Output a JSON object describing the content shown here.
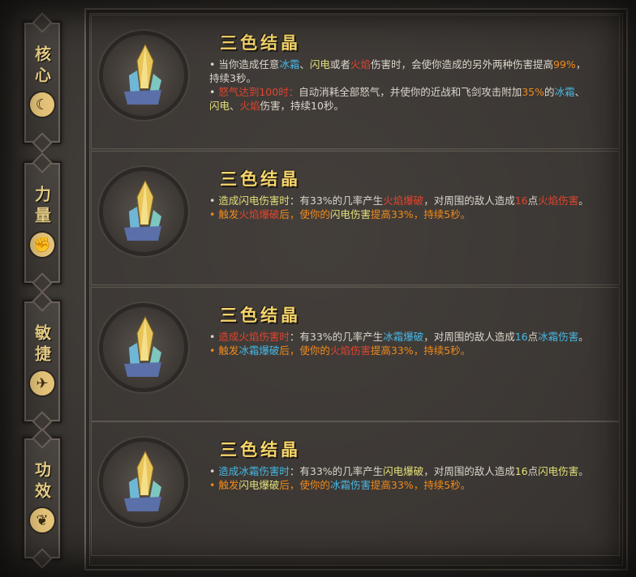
{
  "colors": {
    "title_gold": "#f6d56a",
    "fire_red": "#e0452f",
    "frost_blue": "#46b8e6",
    "lightning_yellow": "#e3e07a",
    "orange_line": "#f08a1c",
    "body_text": "#dcd6cc"
  },
  "nav": {
    "tabs": [
      {
        "label": "核心",
        "icon": "crescent-moon-icon",
        "icon_glyph": "☾"
      },
      {
        "label": "力量",
        "icon": "fist-icon",
        "icon_glyph": "✊"
      },
      {
        "label": "敏捷",
        "icon": "leaping-figure-icon",
        "icon_glyph": "✈"
      },
      {
        "label": "功效",
        "icon": "leaf-icon",
        "icon_glyph": "❦"
      }
    ]
  },
  "entries": [
    {
      "title": "三色结晶",
      "icon": "tricolor-crystal-icon",
      "lines": [
        {
          "style": "normal",
          "parts": [
            {
              "t": "• 当你造成任意",
              "c": ""
            },
            {
              "t": "冰霜",
              "c": "hl-blue"
            },
            {
              "t": "、",
              "c": ""
            },
            {
              "t": "闪电",
              "c": "hl-yellow"
            },
            {
              "t": "或者",
              "c": ""
            },
            {
              "t": "火焰",
              "c": "hl-red"
            },
            {
              "t": "伤害时，会使你造成的另外两种伤害提高",
              "c": ""
            },
            {
              "t": "99%",
              "c": "hl-orange"
            },
            {
              "t": "，持续3秒。",
              "c": ""
            }
          ]
        },
        {
          "style": "normal",
          "parts": [
            {
              "t": "• ",
              "c": ""
            },
            {
              "t": "怒气达到100时：",
              "c": "hl-red"
            },
            {
              "t": "自动消耗全部怒气，并使你的近战和飞剑攻击附加",
              "c": ""
            },
            {
              "t": "35%",
              "c": "hl-orange"
            },
            {
              "t": "的",
              "c": ""
            },
            {
              "t": "冰霜",
              "c": "hl-blue"
            },
            {
              "t": "、",
              "c": ""
            },
            {
              "t": "闪电",
              "c": "hl-yellow"
            },
            {
              "t": "、",
              "c": ""
            },
            {
              "t": "火焰",
              "c": "hl-red"
            },
            {
              "t": "伤害，持续10秒。",
              "c": ""
            }
          ]
        }
      ]
    },
    {
      "title": "三色结晶",
      "icon": "tricolor-crystal-icon",
      "lines": [
        {
          "style": "normal",
          "parts": [
            {
              "t": "• ",
              "c": ""
            },
            {
              "t": "造成闪电伤害时",
              "c": "hl-yellow"
            },
            {
              "t": "：有33%的几率产生",
              "c": ""
            },
            {
              "t": "火焰爆破",
              "c": "hl-red"
            },
            {
              "t": "，对周围的敌人造成",
              "c": ""
            },
            {
              "t": "16",
              "c": "hl-red"
            },
            {
              "t": "点",
              "c": ""
            },
            {
              "t": "火焰伤害",
              "c": "hl-red"
            },
            {
              "t": "。",
              "c": ""
            }
          ]
        },
        {
          "style": "orange",
          "parts": [
            {
              "t": "• 触发",
              "c": ""
            },
            {
              "t": "火焰爆破",
              "c": "hl-red"
            },
            {
              "t": "后，使你的",
              "c": ""
            },
            {
              "t": "闪电伤害",
              "c": "hl-yellow"
            },
            {
              "t": "提高33%，持续5秒。",
              "c": ""
            }
          ]
        }
      ]
    },
    {
      "title": "三色结晶",
      "icon": "tricolor-crystal-icon",
      "lines": [
        {
          "style": "normal",
          "parts": [
            {
              "t": "• ",
              "c": ""
            },
            {
              "t": "造成火焰伤害时",
              "c": "hl-red"
            },
            {
              "t": "：有33%的几率产生",
              "c": ""
            },
            {
              "t": "冰霜爆破",
              "c": "hl-blue"
            },
            {
              "t": "，对周围的敌人造成",
              "c": ""
            },
            {
              "t": "16",
              "c": "hl-blue"
            },
            {
              "t": "点",
              "c": ""
            },
            {
              "t": "冰霜伤害",
              "c": "hl-blue"
            },
            {
              "t": "。",
              "c": ""
            }
          ]
        },
        {
          "style": "orange",
          "parts": [
            {
              "t": "• 触发",
              "c": ""
            },
            {
              "t": "冰霜爆破",
              "c": "hl-blue"
            },
            {
              "t": "后，使你的",
              "c": ""
            },
            {
              "t": "火焰伤害",
              "c": "hl-red"
            },
            {
              "t": "提高33%，持续5秒。",
              "c": ""
            }
          ]
        }
      ]
    },
    {
      "title": "三色结晶",
      "icon": "tricolor-crystal-icon",
      "lines": [
        {
          "style": "normal",
          "parts": [
            {
              "t": "• ",
              "c": ""
            },
            {
              "t": "造成冰霜伤害时",
              "c": "hl-blue"
            },
            {
              "t": "：有33%的几率产生",
              "c": ""
            },
            {
              "t": "闪电爆破",
              "c": "hl-yellow"
            },
            {
              "t": "，对周围的敌人造成",
              "c": ""
            },
            {
              "t": "16",
              "c": "hl-yellow"
            },
            {
              "t": "点",
              "c": ""
            },
            {
              "t": "闪电伤害",
              "c": "hl-yellow"
            },
            {
              "t": "。",
              "c": ""
            }
          ]
        },
        {
          "style": "orange",
          "parts": [
            {
              "t": "• 触发",
              "c": ""
            },
            {
              "t": "闪电爆破",
              "c": "hl-yellow"
            },
            {
              "t": "后，使你的",
              "c": ""
            },
            {
              "t": "冰霜伤害",
              "c": "hl-blue"
            },
            {
              "t": "提高33%，持续5秒。",
              "c": ""
            }
          ]
        }
      ]
    }
  ]
}
